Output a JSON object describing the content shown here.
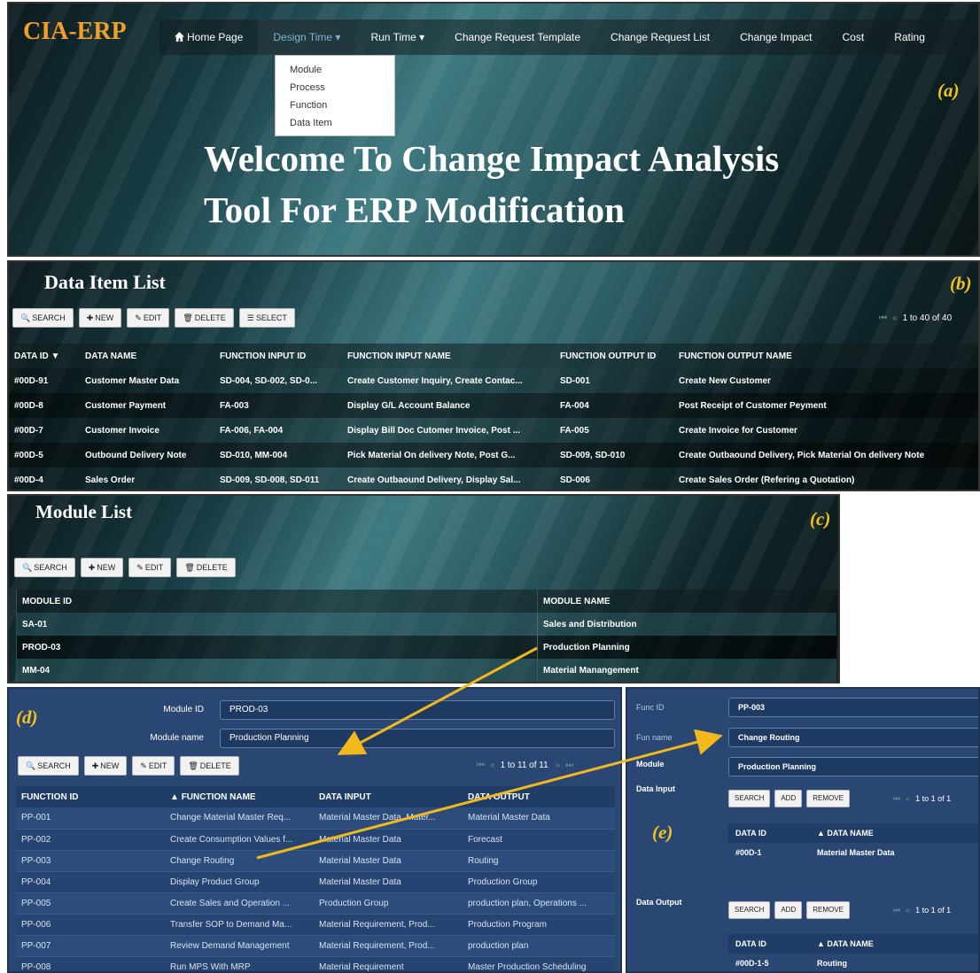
{
  "panel_a": {
    "logo": "CIA-ERP",
    "tag": "(a)",
    "nav": [
      "Home Page",
      "Design Time",
      "Run Time",
      "Change Request Template",
      "Change Request List",
      "Change Impact",
      "Cost",
      "Rating"
    ],
    "dropdown": [
      "Module",
      "Process",
      "Function",
      "Data Item"
    ],
    "welcome_line1": "Welcome To Change Impact Analysis",
    "welcome_line2": "Tool For ERP Modification"
  },
  "panel_b": {
    "title": "Data Item List",
    "tag": "(b)",
    "buttons": [
      "SEARCH",
      "NEW",
      "EDIT",
      "DELETE",
      "SELECT"
    ],
    "pager": "1 to 40 of 40",
    "columns": [
      "DATA ID",
      "DATA NAME",
      "FUNCTION INPUT ID",
      "FUNCTION INPUT NAME",
      "FUNCTION OUTPUT ID",
      "FUNCTION OUTPUT NAME"
    ],
    "rows": [
      [
        "#00D-91",
        "Customer Master Data",
        "SD-004, SD-002, SD-0...",
        "Create Customer Inquiry, Create Contac...",
        "SD-001",
        "Create New Customer"
      ],
      [
        "#00D-8",
        "Customer Payment",
        "FA-003",
        "Display G/L Account Balance",
        "FA-004",
        "Post Receipt of Customer Peyment"
      ],
      [
        "#00D-7",
        "Customer Invoice",
        "FA-006, FA-004",
        "Display Bill Doc Cutomer Invoice, Post ...",
        "FA-005",
        "Create Invoice for Customer"
      ],
      [
        "#00D-5",
        "Outbound Delivery Note",
        "SD-010, MM-004",
        "Pick Material On delivery Note, Post G...",
        "SD-009, SD-010",
        "Create Outbaound Delivery, Pick Material On delivery Note"
      ],
      [
        "#00D-4",
        "Sales Order",
        "SD-009, SD-008, SD-011",
        "Create Outbaound Delivery, Display Sal...",
        "SD-006",
        "Create Sales Order (Refering a Quotation)"
      ]
    ]
  },
  "panel_c": {
    "title": "Module List",
    "tag": "(c)",
    "buttons": [
      "SEARCH",
      "NEW",
      "EDIT",
      "DELETE"
    ],
    "columns": [
      "MODULE ID",
      "MODULE NAME"
    ],
    "rows": [
      [
        "SA-01",
        "Sales and Distribution"
      ],
      [
        "PROD-03",
        "Production Planning"
      ],
      [
        "MM-04",
        "Material Manangement"
      ]
    ]
  },
  "panel_d": {
    "tag": "(d)",
    "module_id_label": "Module ID",
    "module_id_value": "PROD-03",
    "module_name_label": "Module name",
    "module_name_value": "Production Planning",
    "buttons": [
      "SEARCH",
      "NEW",
      "EDIT",
      "DELETE"
    ],
    "pager": "1 to 11 of 11",
    "columns": [
      "FUNCTION ID",
      "FUNCTION NAME",
      "DATA INPUT",
      "DATA OUTPUT"
    ],
    "rows": [
      [
        "PP-001",
        "Change Material Master Req...",
        "Material Master Data, Mater...",
        "Material Master Data"
      ],
      [
        "PP-002",
        "Create Consumption Values f...",
        "Material Master Data",
        "Forecast"
      ],
      [
        "PP-003",
        "Change Routing",
        "Material Master Data",
        "Routing"
      ],
      [
        "PP-004",
        "Display Product Group",
        "Material Master Data",
        "Production Group"
      ],
      [
        "PP-005",
        "Create Sales and Operation ...",
        "Production Group",
        "production plan, Operations ..."
      ],
      [
        "PP-006",
        "Transfer SOP to Demand Ma...",
        "Material Requirement, Prod...",
        "Production Program"
      ],
      [
        "PP-007",
        "Review Demand Management",
        "Material Requirement, Prod...",
        "production plan"
      ],
      [
        "PP-008",
        "Run MPS With MRP",
        "Material Requirement",
        "Master Production Scheduling"
      ]
    ]
  },
  "panel_e": {
    "tag": "(e)",
    "func_id_label": "Func ID",
    "func_id_value": "PP-003",
    "fun_name_label": "Fun name",
    "fun_name_value": "Change Routing",
    "module_label": "Module",
    "module_value": "Production Planning",
    "data_input_label": "Data Input",
    "data_output_label": "Data Output",
    "buttons": [
      "SEARCH",
      "ADD",
      "REMOVE"
    ],
    "input_pager": "1 to 1 of 1",
    "output_pager": "1 to 1 of 1",
    "columns": [
      "DATA ID",
      "DATA NAME"
    ],
    "input_rows": [
      [
        "#00D-1",
        "Material Master Data"
      ]
    ],
    "output_rows": [
      [
        "#00D-1-5",
        "Routing"
      ]
    ]
  },
  "colors": {
    "accent_orange": "#f0a028",
    "tag_yellow": "#f2c41c",
    "arrow_yellow": "#f2b81c",
    "form_blue": "#2a4773"
  }
}
